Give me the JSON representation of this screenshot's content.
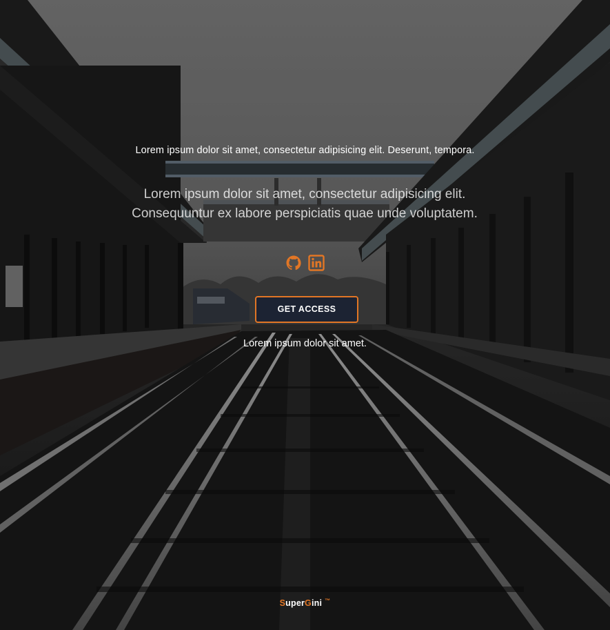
{
  "hero": {
    "tagline": "Lorem ipsum dolor sit amet, consectetur adipisicing elit. Deserunt, tempora.",
    "lead_line_1": "Lorem ipsum dolor sit amet, consectetur adipisicing elit.",
    "lead_line_2": "Consequuntur ex labore perspiciatis quae unde voluptatem.",
    "socials": [
      {
        "icon": "github-icon",
        "color": "#e27625"
      },
      {
        "icon": "linkedin-icon",
        "color": "#e27625"
      }
    ],
    "cta_label": "GET ACCESS",
    "cta_note": "Lorem ipsum dolor sit amet."
  },
  "footer": {
    "brand_s": "S",
    "brand_uper": "uper",
    "brand_g": "G",
    "brand_ini": "ini",
    "trademark": "™"
  },
  "colors": {
    "accent": "#e27625",
    "button_bg": "#1c2333",
    "text": "#ffffff"
  }
}
